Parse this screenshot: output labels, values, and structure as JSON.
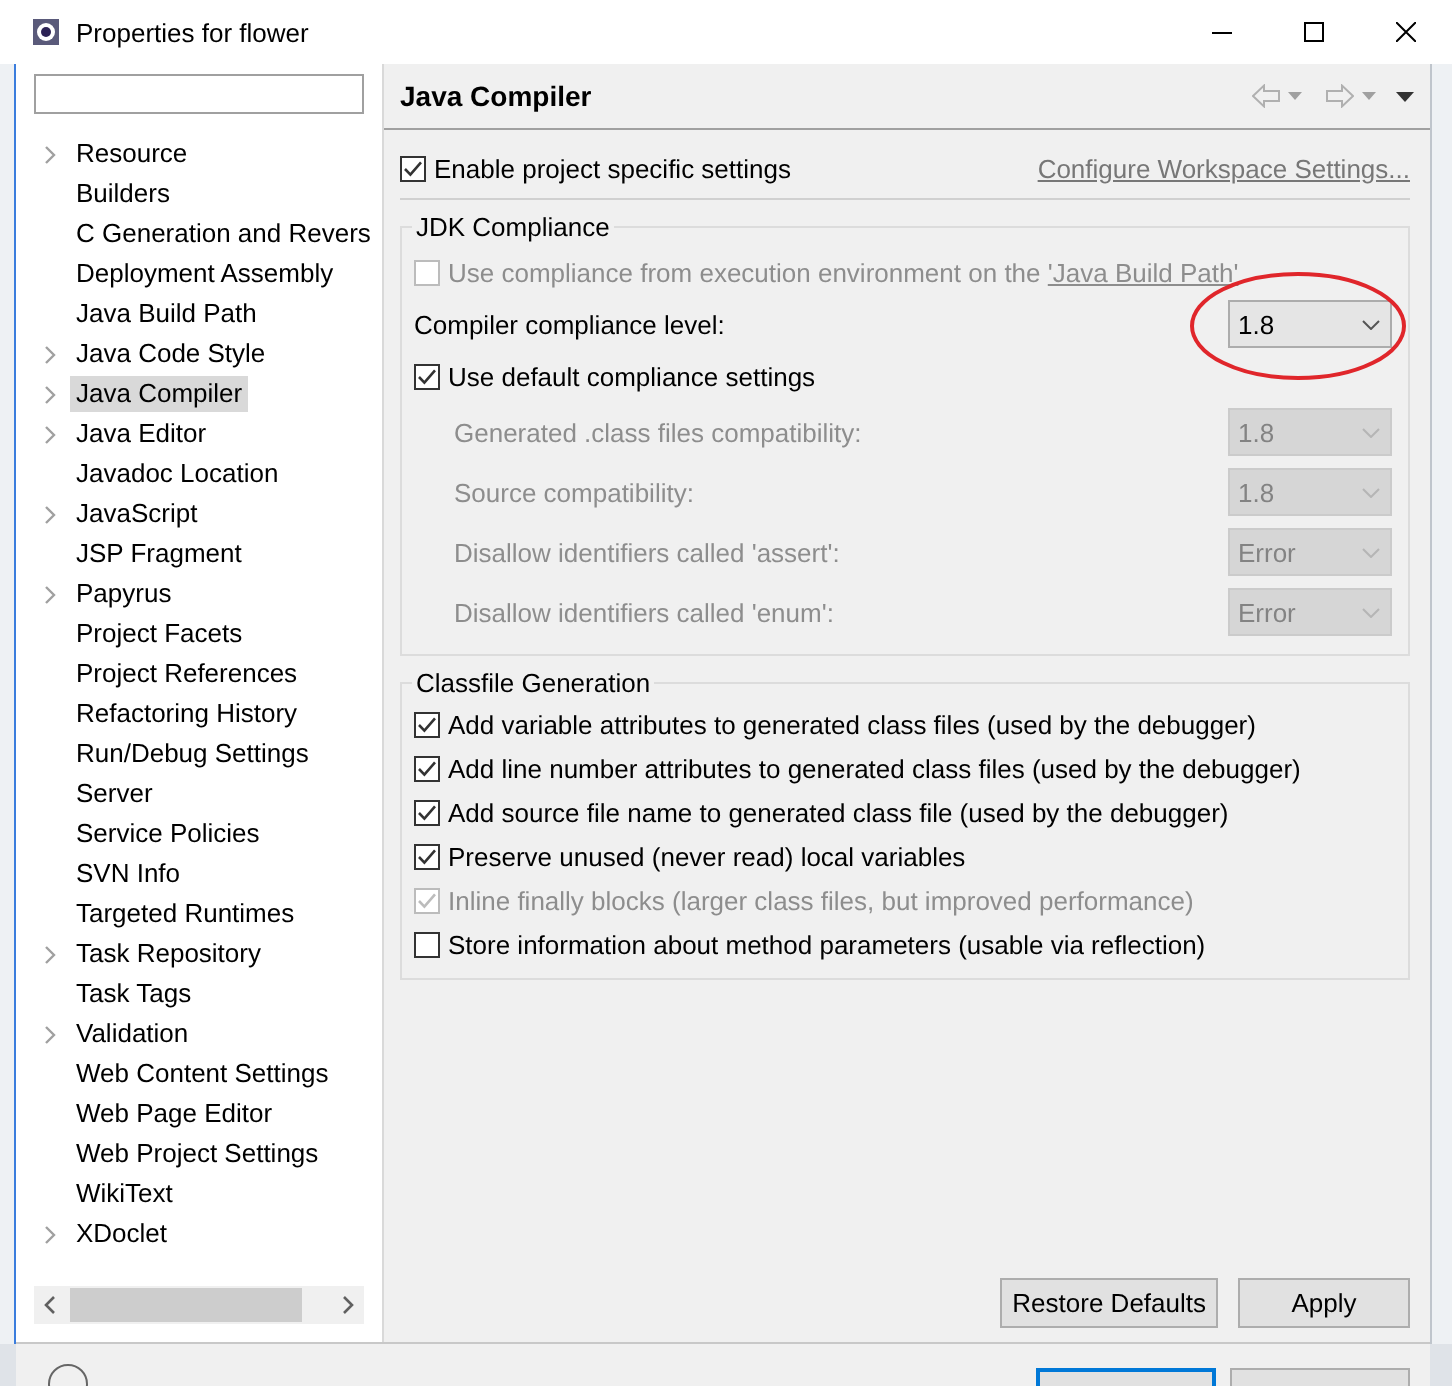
{
  "window": {
    "title": "Properties for flower"
  },
  "tree": [
    {
      "label": "Resource",
      "expandable": true,
      "selected": false
    },
    {
      "label": "Builders",
      "expandable": false,
      "selected": false
    },
    {
      "label": "C Generation and Revers",
      "expandable": false,
      "selected": false
    },
    {
      "label": "Deployment Assembly",
      "expandable": false,
      "selected": false
    },
    {
      "label": "Java Build Path",
      "expandable": false,
      "selected": false
    },
    {
      "label": "Java Code Style",
      "expandable": true,
      "selected": false
    },
    {
      "label": "Java Compiler",
      "expandable": true,
      "selected": true
    },
    {
      "label": "Java Editor",
      "expandable": true,
      "selected": false
    },
    {
      "label": "Javadoc Location",
      "expandable": false,
      "selected": false
    },
    {
      "label": "JavaScript",
      "expandable": true,
      "selected": false
    },
    {
      "label": "JSP Fragment",
      "expandable": false,
      "selected": false
    },
    {
      "label": "Papyrus",
      "expandable": true,
      "selected": false
    },
    {
      "label": "Project Facets",
      "expandable": false,
      "selected": false
    },
    {
      "label": "Project References",
      "expandable": false,
      "selected": false
    },
    {
      "label": "Refactoring History",
      "expandable": false,
      "selected": false
    },
    {
      "label": "Run/Debug Settings",
      "expandable": false,
      "selected": false
    },
    {
      "label": "Server",
      "expandable": false,
      "selected": false
    },
    {
      "label": "Service Policies",
      "expandable": false,
      "selected": false
    },
    {
      "label": "SVN Info",
      "expandable": false,
      "selected": false
    },
    {
      "label": "Targeted Runtimes",
      "expandable": false,
      "selected": false
    },
    {
      "label": "Task Repository",
      "expandable": true,
      "selected": false
    },
    {
      "label": "Task Tags",
      "expandable": false,
      "selected": false
    },
    {
      "label": "Validation",
      "expandable": true,
      "selected": false
    },
    {
      "label": "Web Content Settings",
      "expandable": false,
      "selected": false
    },
    {
      "label": "Web Page Editor",
      "expandable": false,
      "selected": false
    },
    {
      "label": "Web Project Settings",
      "expandable": false,
      "selected": false
    },
    {
      "label": "WikiText",
      "expandable": false,
      "selected": false
    },
    {
      "label": "XDoclet",
      "expandable": true,
      "selected": false
    }
  ],
  "page": {
    "title": "Java Compiler",
    "enable": {
      "label": "Enable project specific settings",
      "checked": true
    },
    "configure_link": "Configure Workspace Settings...",
    "groups": [
      {
        "title": "JDK Compliance",
        "rows": [
          {
            "kind": "checkbox",
            "label": "Use compliance from execution environment on the ",
            "link": "'Java Build Path'",
            "checked": false,
            "disabled": true
          },
          {
            "kind": "combo",
            "label": "Compiler compliance level:",
            "value": "1.8",
            "disabled": false,
            "circled": true
          },
          {
            "kind": "checkbox",
            "label": "Use default compliance settings",
            "checked": true,
            "disabled": false,
            "children": [
              {
                "kind": "combo",
                "label": "Generated .class files compatibility:",
                "value": "1.8",
                "disabled": true,
                "circled": false
              },
              {
                "kind": "combo",
                "label": "Source compatibility:",
                "value": "1.8",
                "disabled": true,
                "circled": false
              },
              {
                "kind": "combo",
                "label": "Disallow identifiers called 'assert':",
                "value": "Error",
                "disabled": true,
                "circled": false
              },
              {
                "kind": "combo",
                "label": "Disallow identifiers called 'enum':",
                "value": "Error",
                "disabled": true,
                "circled": false
              }
            ]
          }
        ]
      },
      {
        "title": "Classfile Generation",
        "rows": [
          {
            "kind": "checkbox",
            "label": "Add variable attributes to generated class files (used by the debugger)",
            "checked": true,
            "disabled": false
          },
          {
            "kind": "checkbox",
            "label": "Add line number attributes to generated class files (used by the debugger)",
            "checked": true,
            "disabled": false
          },
          {
            "kind": "checkbox",
            "label": "Add source file name to generated class file (used by the debugger)",
            "checked": true,
            "disabled": false
          },
          {
            "kind": "checkbox",
            "label": "Preserve unused (never read) local variables",
            "checked": true,
            "disabled": false
          },
          {
            "kind": "checkbox",
            "label": "Inline finally blocks (larger class files, but improved performance)",
            "checked": true,
            "disabled": true
          },
          {
            "kind": "checkbox",
            "label": "Store information about method parameters (usable via reflection)",
            "checked": false,
            "disabled": false
          }
        ]
      }
    ],
    "buttons": [
      "Restore Defaults",
      "Apply"
    ]
  }
}
